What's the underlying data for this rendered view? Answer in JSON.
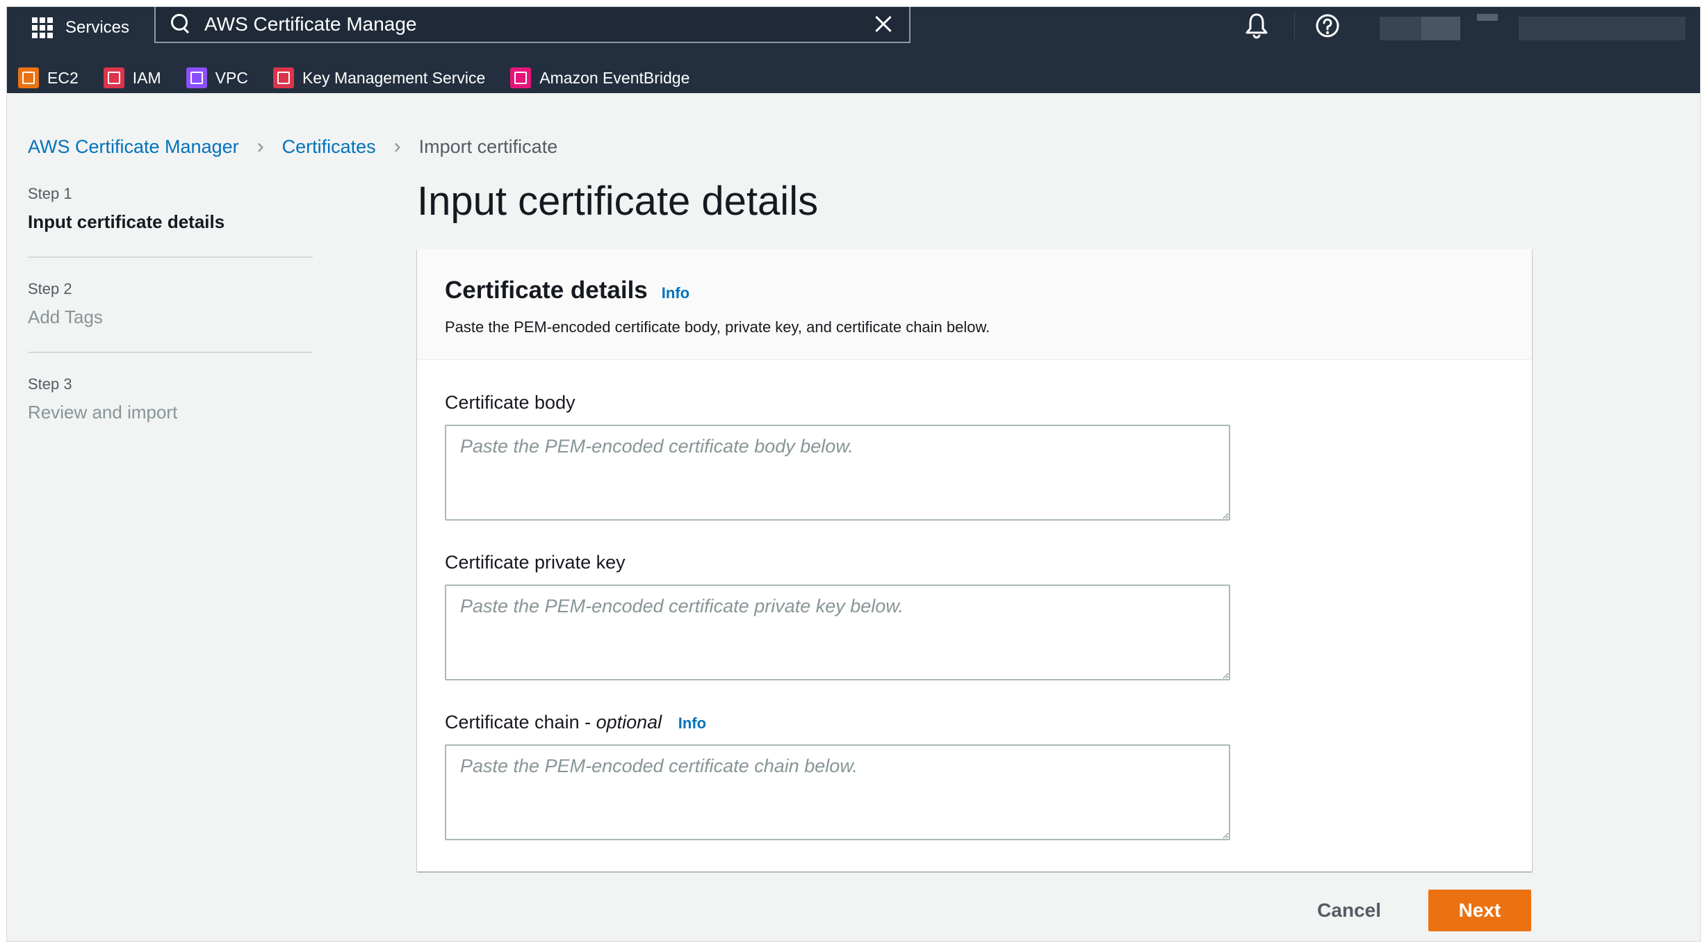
{
  "topnav": {
    "services_label": "Services",
    "search_value": "AWS Certificate Manage",
    "favorites": [
      {
        "label": "EC2",
        "color": "#ec7211"
      },
      {
        "label": "IAM",
        "color": "#dd344c"
      },
      {
        "label": "VPC",
        "color": "#8c4fff"
      },
      {
        "label": "Key Management Service",
        "color": "#dd344c"
      },
      {
        "label": "Amazon EventBridge",
        "color": "#e7157b"
      }
    ]
  },
  "breadcrumb": {
    "items": [
      "AWS Certificate Manager",
      "Certificates"
    ],
    "current": "Import certificate"
  },
  "steps": [
    {
      "number": "Step 1",
      "title": "Input certificate details",
      "active": true
    },
    {
      "number": "Step 2",
      "title": "Add Tags",
      "active": false
    },
    {
      "number": "Step 3",
      "title": "Review and import",
      "active": false
    }
  ],
  "page": {
    "title": "Input certificate details"
  },
  "panel": {
    "title": "Certificate details",
    "info_label": "Info",
    "description": "Paste the PEM-encoded certificate body, private key, and certificate chain below."
  },
  "fields": {
    "body": {
      "label": "Certificate body",
      "placeholder": "Paste the PEM-encoded certificate body below."
    },
    "private_key": {
      "label": "Certificate private key",
      "placeholder": "Paste the PEM-encoded certificate private key below."
    },
    "chain": {
      "label_main": "Certificate chain - ",
      "label_optional": "optional",
      "info_label": "Info",
      "placeholder": "Paste the PEM-encoded certificate chain below."
    }
  },
  "actions": {
    "cancel_label": "Cancel",
    "next_label": "Next"
  },
  "colors": {
    "nav_bg": "#232f3e",
    "link": "#0073bb",
    "primary_button": "#ec7211"
  }
}
